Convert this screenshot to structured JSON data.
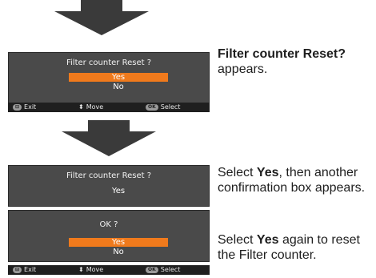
{
  "steps": {
    "first": {
      "title": "Filter counter Reset ?",
      "options": [
        "Yes",
        "No"
      ],
      "status": {
        "exit_key": "⊟",
        "exit": "Exit",
        "move_icon": "⬍",
        "move": "Move",
        "select_key": "OK",
        "select": "Select"
      },
      "desc_bold": "Filter counter Reset?",
      "desc_rest": "appears."
    },
    "second": {
      "title": "Filter counter Reset ?",
      "option": "Yes",
      "desc_pre": "Select ",
      "desc_bold": "Yes",
      "desc_rest": ", then another confirmation box appears."
    },
    "third": {
      "title": "OK ?",
      "options": [
        "Yes",
        "No"
      ],
      "status": {
        "exit_key": "⊟",
        "exit": "Exit",
        "move_icon": "⬍",
        "move": "Move",
        "select_key": "OK",
        "select": "Select"
      },
      "desc_pre": "Select ",
      "desc_bold": "Yes",
      "desc_rest": " again to reset the Filter counter."
    }
  },
  "colors": {
    "selected": "#f07a1c",
    "screen": "#4a4a4a",
    "statusbar": "#1f1f1f",
    "arrow": "#3a3a3a"
  }
}
